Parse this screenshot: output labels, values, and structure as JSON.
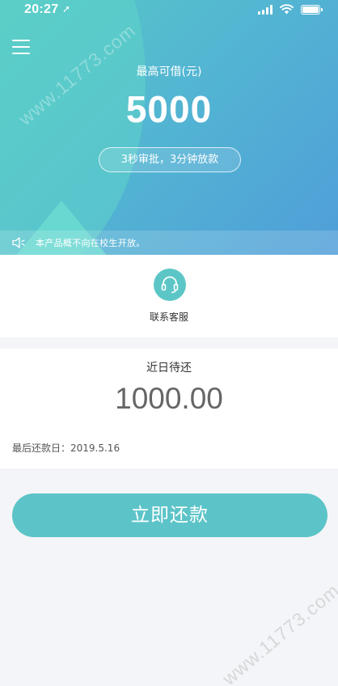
{
  "status_bar": {
    "time": "20:27",
    "location_arrow": "➚"
  },
  "header": {
    "limit_label": "最高可借(元)",
    "limit_amount": "5000",
    "promo": "3秒审批，3分钟放款",
    "notice": "本产品概不向在校生开放。"
  },
  "service": {
    "label": "联系客服"
  },
  "repay": {
    "title": "近日待还",
    "amount": "1000.00",
    "due_date": "最后还款日：2019.5.16",
    "button_label": "立即还款"
  },
  "watermark": {
    "text": "www.11773.com"
  },
  "colors": {
    "accent": "#5cc4c8",
    "header_gradient_start": "#58c9c5",
    "header_gradient_end": "#4f9ed9"
  },
  "icons": {
    "menu": "hamburger-icon",
    "notice": "speaker-icon",
    "service": "headset-icon",
    "signal": "signal-icon",
    "wifi": "wifi-icon",
    "battery": "battery-icon"
  }
}
